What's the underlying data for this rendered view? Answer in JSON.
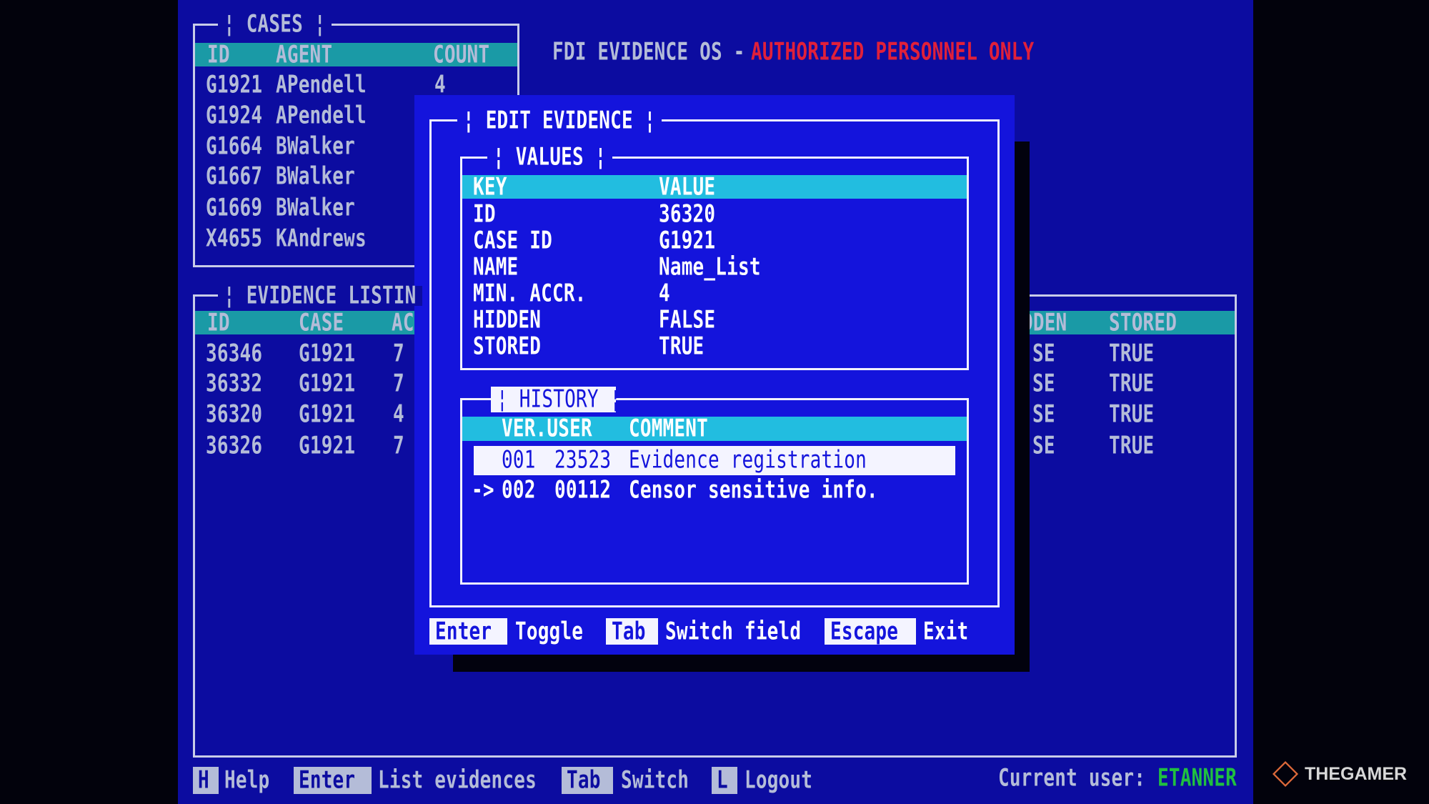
{
  "os_title": {
    "prefix": "FDI EVIDENCE OS -",
    "warning": "AUTHORIZED PERSONNEL ONLY"
  },
  "cases": {
    "title": "¦ CASES ¦",
    "columns": [
      "ID",
      "AGENT",
      "COUNT"
    ],
    "rows": [
      [
        "G1921",
        "APendell",
        "4"
      ],
      [
        "G1924",
        "APendell",
        ""
      ],
      [
        "G1664",
        "BWalker",
        ""
      ],
      [
        "G1667",
        "BWalker",
        ""
      ],
      [
        "G1669",
        "BWalker",
        ""
      ],
      [
        "X4655",
        "KAndrews",
        ""
      ]
    ]
  },
  "evidence_listing": {
    "title": "¦ EVIDENCE LISTIN",
    "columns": [
      "ID",
      "CASE",
      "AC",
      "DDEN",
      "STORED"
    ],
    "rows": [
      [
        "36346",
        "G1921",
        "7",
        "SE",
        "TRUE"
      ],
      [
        "36332",
        "G1921",
        "7",
        "SE",
        "TRUE"
      ],
      [
        "36320",
        "G1921",
        "4",
        "SE",
        "TRUE"
      ],
      [
        "36326",
        "G1921",
        "7",
        "SE",
        "TRUE"
      ]
    ]
  },
  "edit_evidence": {
    "title": "¦ EDIT EVIDENCE ¦",
    "values": {
      "title": "¦ VALUES ¦",
      "columns": [
        "KEY",
        "VALUE"
      ],
      "rows": [
        [
          "ID",
          "36320"
        ],
        [
          "CASE ID",
          "G1921"
        ],
        [
          "NAME",
          "Name_List"
        ],
        [
          "MIN. ACCR.",
          "4"
        ],
        [
          "HIDDEN",
          "FALSE"
        ],
        [
          "STORED",
          "TRUE"
        ]
      ]
    },
    "history": {
      "title": "¦ HISTORY ¦",
      "columns": [
        "VER.USER",
        "COMMENT"
      ],
      "rows": [
        {
          "marker": "",
          "ver": "001",
          "user": "23523",
          "comment": "Evidence registration",
          "selected": true
        },
        {
          "marker": "->",
          "ver": "002",
          "user": "00112",
          "comment": "Censor sensitive info.",
          "selected": false
        }
      ]
    },
    "shortcuts": [
      {
        "key": "Enter",
        "label": "Toggle"
      },
      {
        "key": "Tab",
        "label": "Switch field"
      },
      {
        "key": "Escape",
        "label": "Exit"
      }
    ]
  },
  "footer": {
    "shortcuts": [
      {
        "key": "H",
        "label": "Help"
      },
      {
        "key": "Enter",
        "label": "List evidences"
      },
      {
        "key": "Tab",
        "label": "Switch"
      },
      {
        "key": "L",
        "label": "Logout"
      }
    ],
    "current_user_label": "Current user:",
    "current_user": "ETANNER"
  },
  "watermark": "THEGAMER",
  "colors": {
    "screen": "#0c0ca0",
    "modal": "#1414dc",
    "header_bar": "#1a9aa6",
    "modal_header": "#22bde0",
    "warning": "#e0203a",
    "user": "#20c040"
  }
}
